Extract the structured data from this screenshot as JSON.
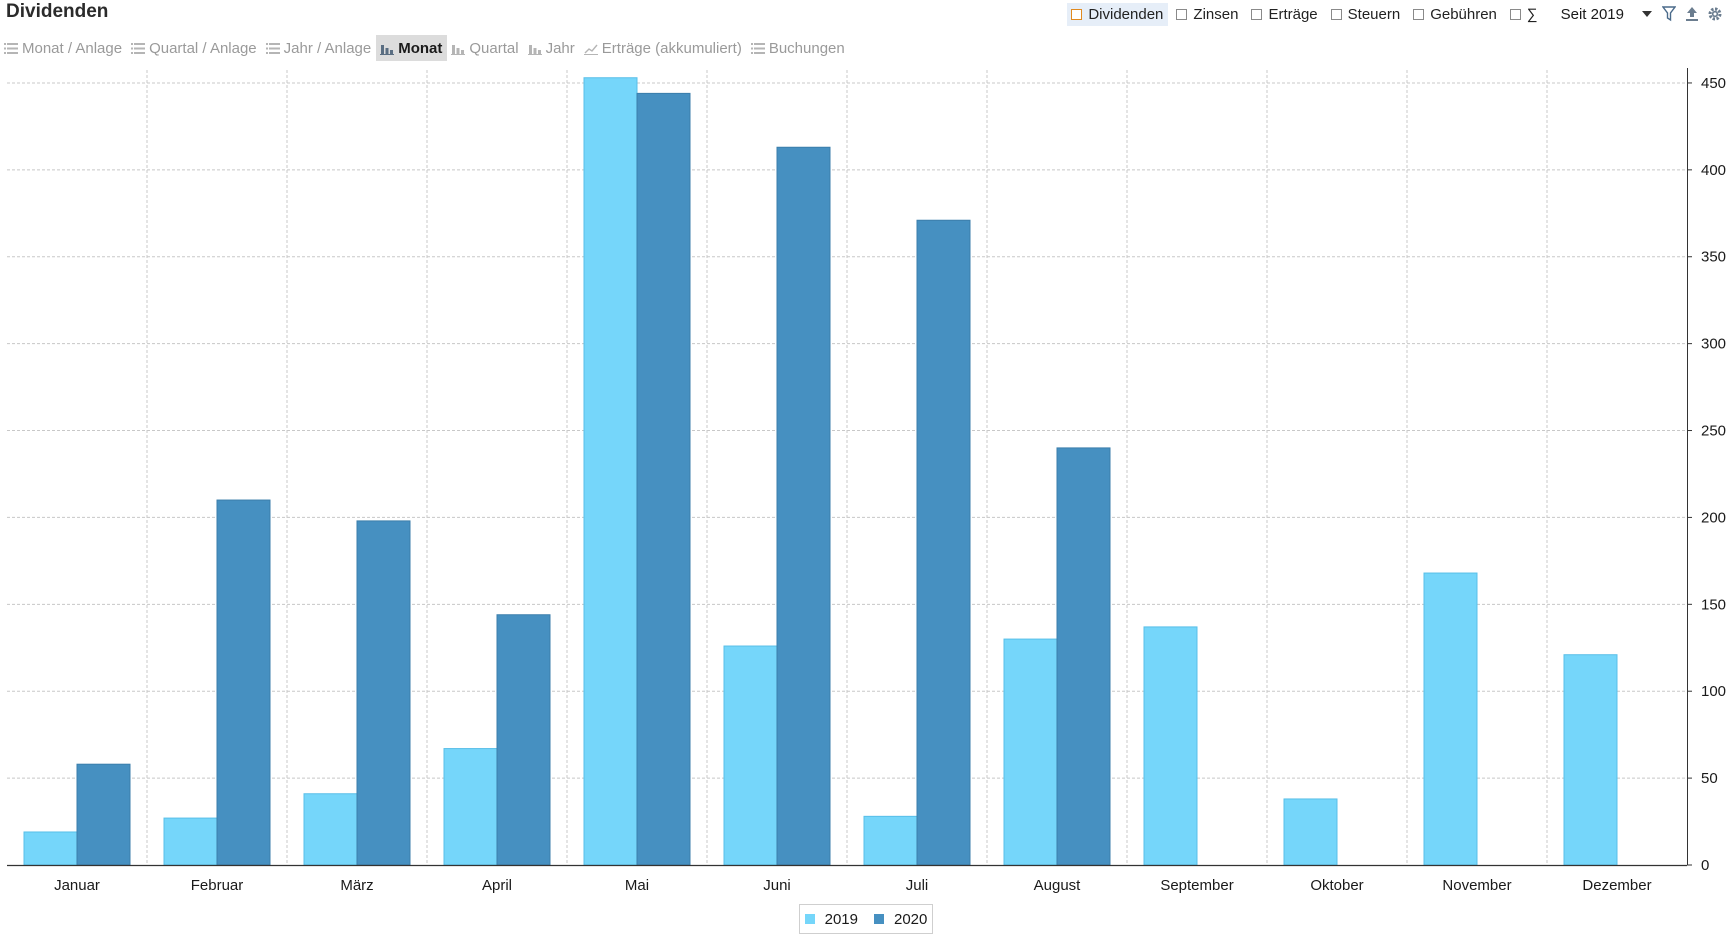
{
  "header": {
    "title": "Dividenden",
    "toggles": [
      {
        "label": "Dividenden",
        "active": true
      },
      {
        "label": "Zinsen",
        "active": false
      },
      {
        "label": "Erträge",
        "active": false
      },
      {
        "label": "Steuern",
        "active": false
      },
      {
        "label": "Gebühren",
        "active": false
      },
      {
        "label": "∑",
        "active": false
      }
    ],
    "period": "Seit 2019",
    "icons": [
      "filter-icon",
      "export-icon",
      "gear-icon"
    ]
  },
  "viewbar": {
    "tabs": [
      {
        "label": "Monat / Anlage",
        "icon": "list-icon",
        "active": false
      },
      {
        "label": "Quartal / Anlage",
        "icon": "list-icon",
        "active": false
      },
      {
        "label": "Jahr / Anlage",
        "icon": "list-icon",
        "active": false
      },
      {
        "label": "Monat",
        "icon": "bar-chart-icon",
        "active": true
      },
      {
        "label": "Quartal",
        "icon": "bar-chart-icon",
        "active": false
      },
      {
        "label": "Jahr",
        "icon": "bar-chart-icon",
        "active": false
      },
      {
        "label": "Erträge (akkumuliert)",
        "icon": "line-chart-icon",
        "active": false
      },
      {
        "label": "Buchungen",
        "icon": "list-icon",
        "active": false
      }
    ]
  },
  "chart_data": {
    "type": "bar",
    "title": "",
    "xlabel": "",
    "ylabel": "",
    "categories": [
      "Januar",
      "Februar",
      "März",
      "April",
      "Mai",
      "Juni",
      "Juli",
      "August",
      "September",
      "Oktober",
      "November",
      "Dezember"
    ],
    "series": [
      {
        "name": "2019",
        "color": "#75d6fa",
        "values": [
          19,
          27,
          41,
          67,
          453,
          126,
          28,
          130,
          137,
          38,
          168,
          121
        ]
      },
      {
        "name": "2020",
        "color": "#4690c1",
        "values": [
          58,
          210,
          198,
          144,
          444,
          413,
          371,
          240,
          0,
          0,
          0,
          0
        ]
      }
    ],
    "yticks": [
      0,
      50,
      100,
      150,
      200,
      250,
      300,
      350,
      400,
      450
    ],
    "ylim": [
      0,
      450
    ],
    "y_axis_side": "right",
    "grid": true,
    "legend_position": "bottom-center"
  }
}
